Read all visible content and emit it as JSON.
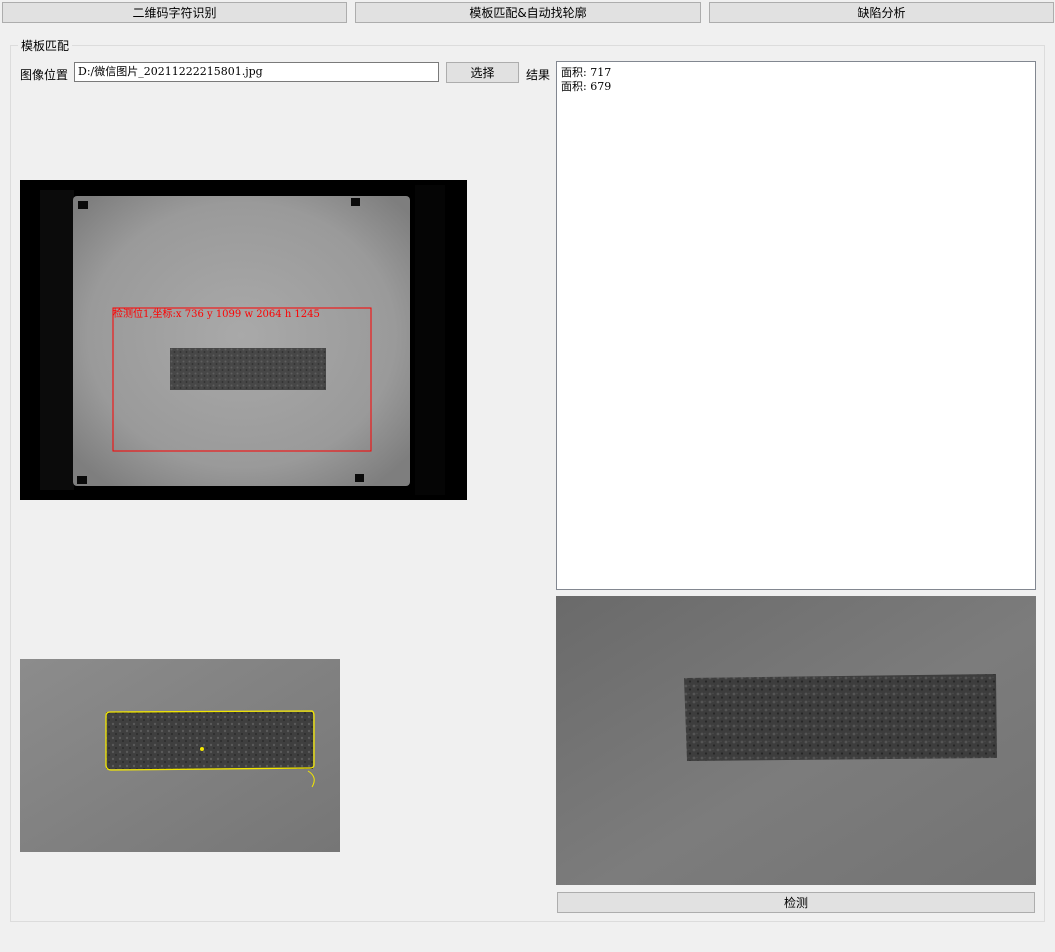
{
  "tabs": [
    {
      "label": "二维码字符识别"
    },
    {
      "label": "模板匹配&自动找轮廓"
    },
    {
      "label": "缺陷分析"
    }
  ],
  "group": {
    "title": "模板匹配",
    "image_path_label": "图像位置",
    "image_path_value": "D:/微信图片_20211222215801.jpg",
    "select_button": "选择",
    "result_label": "结果",
    "results": [
      "面积: 717",
      "面积: 679"
    ],
    "detect_button": "检测",
    "match_annotation": "检测位1,坐标:x 736 y 1099 w 2064 h 1245"
  },
  "colors": {
    "match_box": "#ff0000",
    "contour": "#f2e600"
  }
}
